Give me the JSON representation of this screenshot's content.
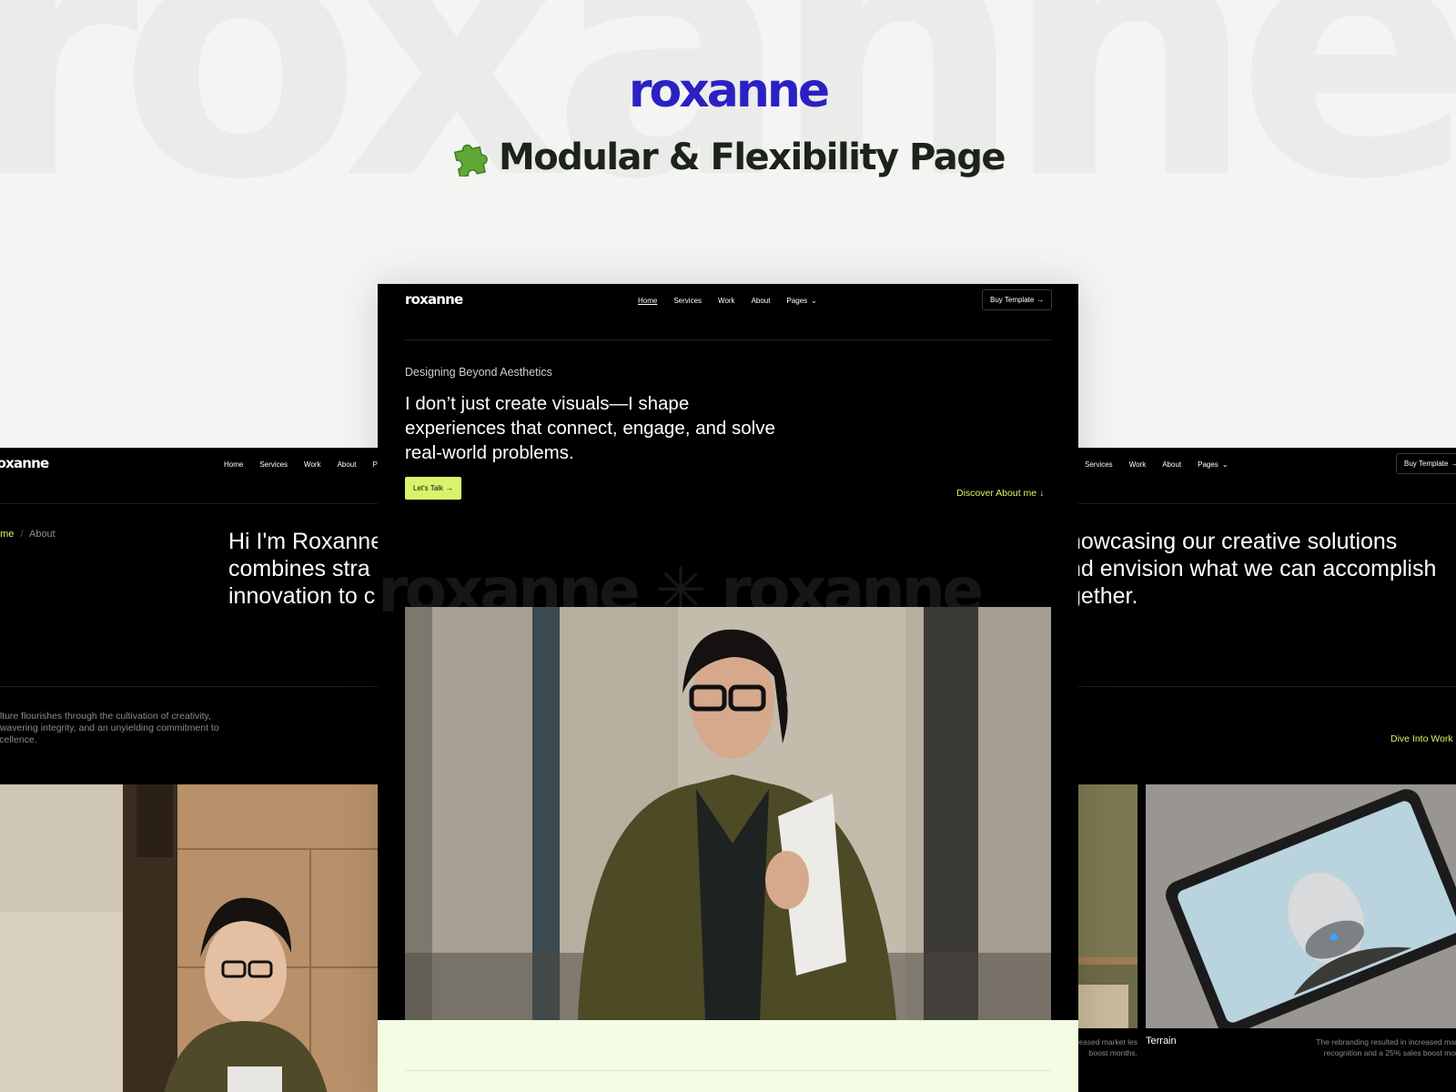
{
  "background": {
    "watermark": "roxanne"
  },
  "header": {
    "brand": "roxanne",
    "title": "Modular & Flexibility Page",
    "icon": "puzzle-piece-icon"
  },
  "colors": {
    "brand": "#2b21c3",
    "accent": "#d9f36a",
    "dark": "#000000",
    "light_band": "#f3fde3"
  },
  "center": {
    "nav": {
      "logo": "roxanne",
      "links": [
        "Home",
        "Services",
        "Work",
        "About",
        "Pages"
      ],
      "cta": "Buy Template"
    },
    "kicker": "Designing Beyond Aesthetics",
    "headline": "I don’t just create visuals—I shape experiences that connect, engage, and solve real-world problems.",
    "primary_button": "Let's Talk",
    "discover_link": "Discover About me",
    "watermark": "roxanne ✳ roxanne"
  },
  "left": {
    "nav": {
      "logo": "roxanne",
      "links": [
        "Home",
        "Services",
        "Work",
        "About",
        "Pag"
      ]
    },
    "breadcrumb": {
      "home": "ome",
      "separator": "/",
      "current": "About"
    },
    "hero_lines": [
      "Hi I'm Roxanne",
      "combines stra",
      "innovation to c"
    ],
    "quote": "ulture flourishes through the cultivation of creativity, nwavering integrity, and an unyielding commitment to xcellence."
  },
  "right": {
    "nav": {
      "links": [
        "Services",
        "Work",
        "About",
        "Pages"
      ],
      "cta": "Buy Template"
    },
    "hero_lines": [
      "howcasing our creative solutions",
      "nd envision what we can accomplish",
      "gether."
    ],
    "dive_link": "Dive Into Work",
    "card_left_desc": "increased market les boost months.",
    "card_title": "Terrain",
    "card_right_desc": "The rebranding resulted in increased mark recognition and a 25% sales boost mont"
  }
}
